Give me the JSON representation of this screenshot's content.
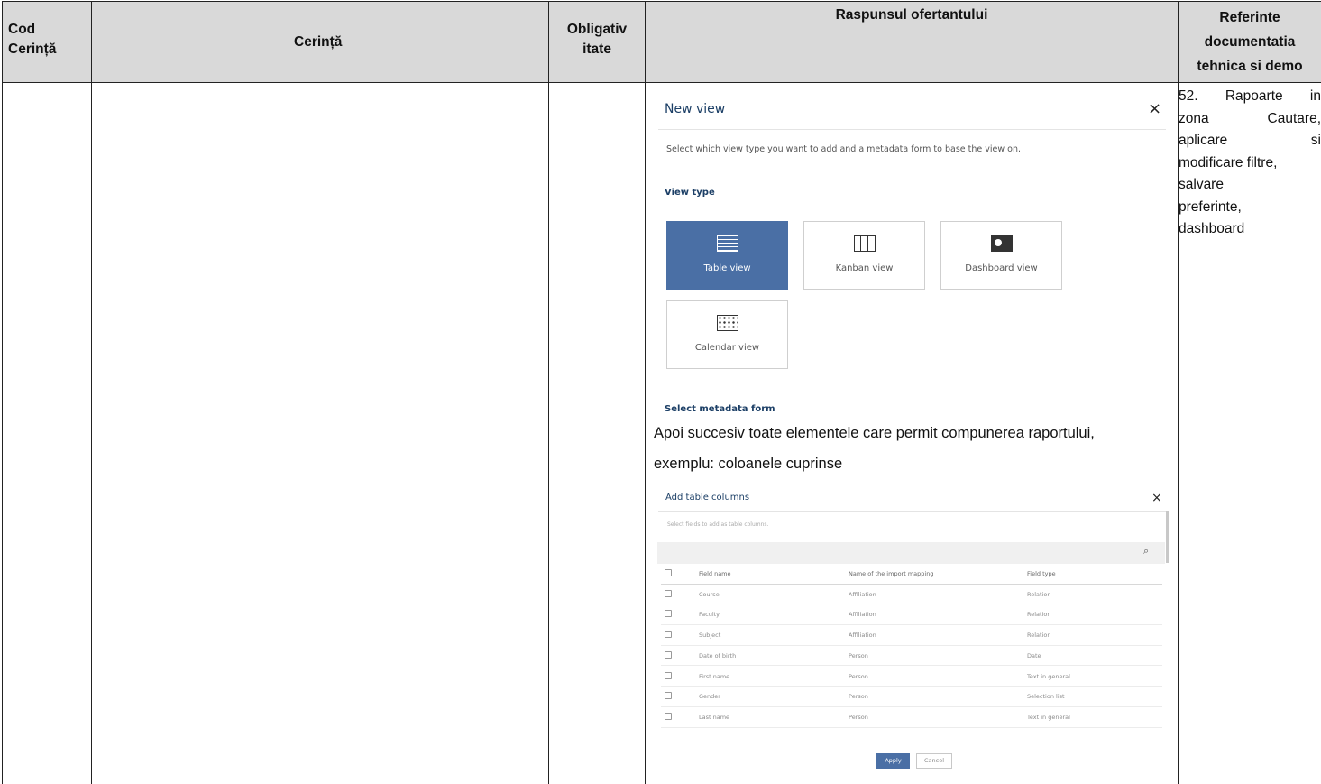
{
  "table": {
    "headers": {
      "cod_line1": "Cod",
      "cod_line2": "Cerință",
      "cerinta": "Cerință",
      "obligativ_line1": "Obligativ",
      "obligativ_line2": "itate",
      "raspuns": "Raspunsul ofertantului",
      "ref_line1": "Referinte",
      "ref_line2": "documentatia",
      "ref_line3": "tehnica si demo"
    },
    "reference": {
      "l1a": "52.",
      "l1b": "Rapoarte",
      "l1c": "in",
      "l2a": "zona",
      "l2b": "Cautare,",
      "l3a": "aplicare",
      "l3b": "si",
      "l4": "modificare filtre,",
      "l5": "salvare",
      "l6": "preferinte,",
      "l7": "dashboard"
    }
  },
  "new_view_dialog": {
    "title": "New view",
    "close": "×",
    "description": "Select which view type you want to add and a metadata form to base the view on.",
    "view_type_label": "View type",
    "view_types": [
      {
        "label": "Table view",
        "selected": true,
        "icon": "table-icon"
      },
      {
        "label": "Kanban view",
        "selected": false,
        "icon": "kanban-icon"
      },
      {
        "label": "Dashboard view",
        "selected": false,
        "icon": "dashboard-icon"
      },
      {
        "label": "Calendar view",
        "selected": false,
        "icon": "calendar-icon"
      }
    ],
    "metadata_label": "Select metadata form"
  },
  "paragraph": {
    "line1": "Apoi succesiv toate elementele care permit compunerea raportului,",
    "line2": "exemplu: coloanele cuprinse"
  },
  "add_columns_dialog": {
    "title": "Add table columns",
    "close": "×",
    "description": "Select fields to add as table columns.",
    "search_icon": "search-icon",
    "columns": [
      "Field name",
      "Name of the import mapping",
      "Field type"
    ],
    "rows": [
      {
        "field": "Course",
        "mapping": "Affiliation",
        "type": "Relation"
      },
      {
        "field": "Faculty",
        "mapping": "Affiliation",
        "type": "Relation"
      },
      {
        "field": "Subject",
        "mapping": "Affiliation",
        "type": "Relation"
      },
      {
        "field": "Date of birth",
        "mapping": "Person",
        "type": "Date"
      },
      {
        "field": "First name",
        "mapping": "Person",
        "type": "Text in general"
      },
      {
        "field": "Gender",
        "mapping": "Person",
        "type": "Selection list"
      },
      {
        "field": "Last name",
        "mapping": "Person",
        "type": "Text in general"
      }
    ],
    "apply": "Apply",
    "cancel": "Cancel"
  }
}
